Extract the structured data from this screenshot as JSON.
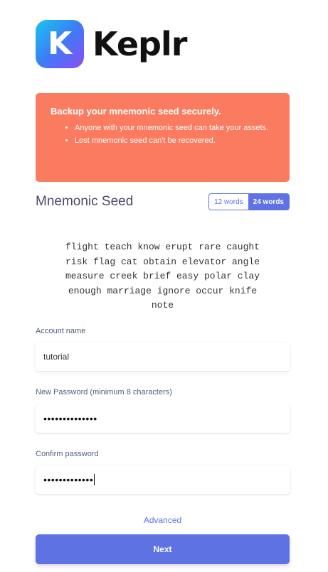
{
  "brand": {
    "logo_letter": "K",
    "name": "Keplr",
    "gradient": [
      "#17c6f0",
      "#3d7cf6",
      "#8a4cf7"
    ]
  },
  "alert": {
    "title": "Backup your mnemonic seed securely.",
    "items": [
      "Anyone with your mnemonic seed can take your assets.",
      "Lost mnemonic seed can't be recovered."
    ],
    "color": "#fb7b60"
  },
  "seed": {
    "title": "Mnemonic Seed",
    "options": [
      "12 words",
      "24 words"
    ],
    "selected": "24 words",
    "words": "flight teach know erupt rare caught\nrisk flag cat obtain elevator angle\nmeasure creek brief easy polar clay\nenough marriage ignore occur knife\nnote"
  },
  "form": {
    "account_name_label": "Account name",
    "account_name_value": "tutorial",
    "new_password_label": "New Password (minimum 8 characters)",
    "new_password_value": "••••••••••••••",
    "confirm_password_label": "Confirm password",
    "confirm_password_value": "•••••••••••••"
  },
  "advanced_label": "Advanced",
  "next_label": "Next",
  "accent_color": "#5e72e4"
}
